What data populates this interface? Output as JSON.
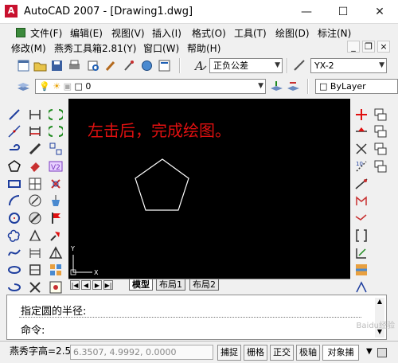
{
  "window": {
    "title": "AutoCAD 2007 - [Drawing1.dwg]",
    "logo": "A",
    "minimize": "—",
    "maximize": "☐",
    "close": "✕"
  },
  "menu_row1": [
    {
      "label": "文件(F)"
    },
    {
      "label": "编辑(E)"
    },
    {
      "label": "视图(V)"
    },
    {
      "label": "插入(I)"
    },
    {
      "label": "格式(O)"
    },
    {
      "label": "工具(T)"
    },
    {
      "label": "绘图(D)"
    },
    {
      "label": "标注(N)"
    }
  ],
  "menu_row2": [
    {
      "label": "修改(M)"
    },
    {
      "label": "燕秀工具箱2.81(Y)"
    },
    {
      "label": "窗口(W)"
    },
    {
      "label": "帮助(H)"
    }
  ],
  "mdi_buttons": {
    "minimize": "_",
    "restore": "❐",
    "close": "×"
  },
  "toolbar1": {
    "text_style": "正负公差",
    "dim_style": "YX-2"
  },
  "toolbar2": {
    "layer": "0",
    "linetype": "ByLayer"
  },
  "canvas": {
    "note": "左击后，完成绘图。",
    "ucs_y": "Y",
    "ucs_x": "X"
  },
  "layout_tabs": [
    "模型",
    "布局1",
    "布局2"
  ],
  "tab_nav": [
    "|◀",
    "◀",
    "▶",
    "▶|"
  ],
  "command": {
    "line1": "指定圆的半径:",
    "line2": "命令:"
  },
  "status": {
    "text_height": "燕秀字高=2.5",
    "coords": "6.3507, 4.9992, 0.0000",
    "buttons": [
      "捕捉",
      "栅格",
      "正交",
      "极轴",
      "对象捕"
    ]
  },
  "watermark": "Baidu经验"
}
